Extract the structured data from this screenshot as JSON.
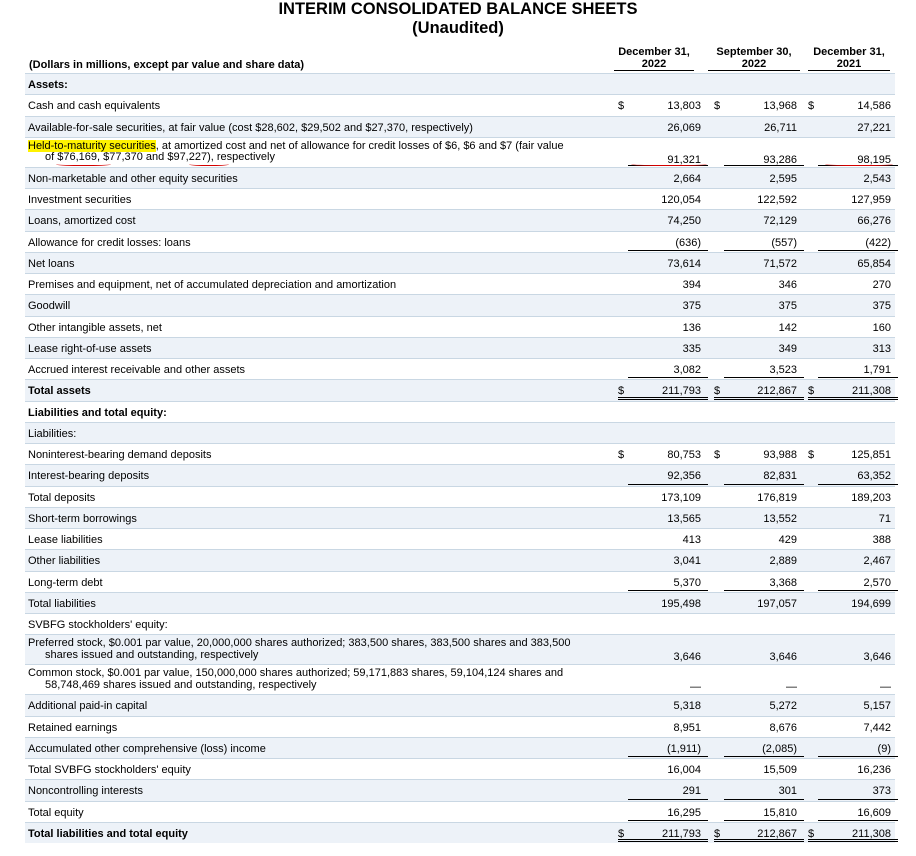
{
  "title": "INTERIM CONSOLIDATED BALANCE SHEETS",
  "subtitle": "(Unaudited)",
  "unit_label": "(Dollars in millions, except par value and share data)",
  "columns": [
    {
      "line1": "December 31,",
      "line2": "2022"
    },
    {
      "line1": "September 30,",
      "line2": "2022"
    },
    {
      "line1": "December 31,",
      "line2": "2021"
    }
  ],
  "currency_symbol": "$",
  "rows": [
    {
      "label": "Assets:",
      "bold": true,
      "shade": true,
      "values": [
        "",
        "",
        ""
      ]
    },
    {
      "label": "Cash and cash equivalents",
      "values": [
        "13,803",
        "13,968",
        "14,586"
      ],
      "dollar": true
    },
    {
      "label": "Available-for-sale securities, at fair value (cost $28,602, $29,502 and $27,370, respectively)",
      "shade": true,
      "values": [
        "26,069",
        "26,711",
        "27,221"
      ]
    },
    {
      "label_hl": "Held-to-maturity securities",
      "label_rest": ", at amortized cost and net of allowance for credit losses of $6, $6 and $7 (fair value",
      "label_line2": "of $76,169, $77,370 and $97,227), respectively",
      "tall": true,
      "values": [
        "91,321",
        "93,286",
        "98,195"
      ],
      "underline": true
    },
    {
      "label": "Non-marketable and other equity securities",
      "shade": true,
      "values": [
        "2,664",
        "2,595",
        "2,543"
      ]
    },
    {
      "label": "Investment securities",
      "values": [
        "120,054",
        "122,592",
        "127,959"
      ],
      "topline": true
    },
    {
      "label": "Loans, amortized cost",
      "shade": true,
      "values": [
        "74,250",
        "72,129",
        "66,276"
      ]
    },
    {
      "label": "Allowance for credit losses: loans",
      "values": [
        "(636)",
        "(557)",
        "(422)"
      ],
      "underline": true
    },
    {
      "label": "Net loans",
      "shade": true,
      "values": [
        "73,614",
        "71,572",
        "65,854"
      ]
    },
    {
      "label": "Premises and equipment, net of accumulated depreciation and amortization",
      "values": [
        "394",
        "346",
        "270"
      ]
    },
    {
      "label": "Goodwill",
      "shade": true,
      "values": [
        "375",
        "375",
        "375"
      ]
    },
    {
      "label": "Other intangible assets, net",
      "values": [
        "136",
        "142",
        "160"
      ]
    },
    {
      "label": "Lease right-of-use assets",
      "shade": true,
      "values": [
        "335",
        "349",
        "313"
      ]
    },
    {
      "label": "Accrued interest receivable and other assets",
      "values": [
        "3,082",
        "3,523",
        "1,791"
      ],
      "underline": true
    },
    {
      "label": "Total assets",
      "bold": true,
      "shade": true,
      "values": [
        "211,793",
        "212,867",
        "211,308"
      ],
      "dollar": true,
      "double": true
    },
    {
      "label": "Liabilities and total equity:",
      "bold": true,
      "values": [
        "",
        "",
        ""
      ]
    },
    {
      "label": "Liabilities:",
      "shade": true,
      "values": [
        "",
        "",
        ""
      ]
    },
    {
      "label": "Noninterest-bearing demand deposits",
      "values": [
        "80,753",
        "93,988",
        "125,851"
      ],
      "dollar": true
    },
    {
      "label": "Interest-bearing deposits",
      "shade": true,
      "values": [
        "92,356",
        "82,831",
        "63,352"
      ],
      "underline": true
    },
    {
      "label": "Total deposits",
      "values": [
        "173,109",
        "176,819",
        "189,203"
      ]
    },
    {
      "label": "Short-term borrowings",
      "shade": true,
      "values": [
        "13,565",
        "13,552",
        "71"
      ]
    },
    {
      "label": "Lease liabilities",
      "values": [
        "413",
        "429",
        "388"
      ]
    },
    {
      "label": "Other liabilities",
      "shade": true,
      "values": [
        "3,041",
        "2,889",
        "2,467"
      ]
    },
    {
      "label": "Long-term debt",
      "values": [
        "5,370",
        "3,368",
        "2,570"
      ],
      "underline": true
    },
    {
      "label": "Total liabilities",
      "shade": true,
      "values": [
        "195,498",
        "197,057",
        "194,699"
      ]
    },
    {
      "label": "SVBFG stockholders' equity:",
      "values": [
        "",
        "",
        ""
      ]
    },
    {
      "label": "Preferred stock, $0.001 par value, 20,000,000 shares authorized; 383,500 shares, 383,500 shares and 383,500",
      "label_line2": "shares issued and outstanding, respectively",
      "tall": true,
      "shade": true,
      "values": [
        "3,646",
        "3,646",
        "3,646"
      ]
    },
    {
      "label": "Common stock, $0.001 par value, 150,000,000 shares authorized; 59,171,883 shares, 59,104,124 shares and",
      "label_line2": "58,748,469 shares issued and outstanding, respectively",
      "tall": true,
      "values": [
        "—",
        "—",
        "—"
      ]
    },
    {
      "label": "Additional paid-in capital",
      "shade": true,
      "values": [
        "5,318",
        "5,272",
        "5,157"
      ]
    },
    {
      "label": "Retained earnings",
      "values": [
        "8,951",
        "8,676",
        "7,442"
      ]
    },
    {
      "label": "Accumulated other comprehensive (loss) income",
      "shade": true,
      "values": [
        "(1,911)",
        "(2,085)",
        "(9)"
      ],
      "underline": true
    },
    {
      "label": "Total SVBFG stockholders' equity",
      "values": [
        "16,004",
        "15,509",
        "16,236"
      ]
    },
    {
      "label": "Noncontrolling interests",
      "shade": true,
      "values": [
        "291",
        "301",
        "373"
      ],
      "underline": true
    },
    {
      "label": "Total equity",
      "values": [
        "16,295",
        "15,810",
        "16,609"
      ],
      "underline": true
    },
    {
      "label": "Total liabilities and total equity",
      "bold": true,
      "shade": true,
      "values": [
        "211,793",
        "212,867",
        "211,308"
      ],
      "dollar": true,
      "double": true
    }
  ]
}
